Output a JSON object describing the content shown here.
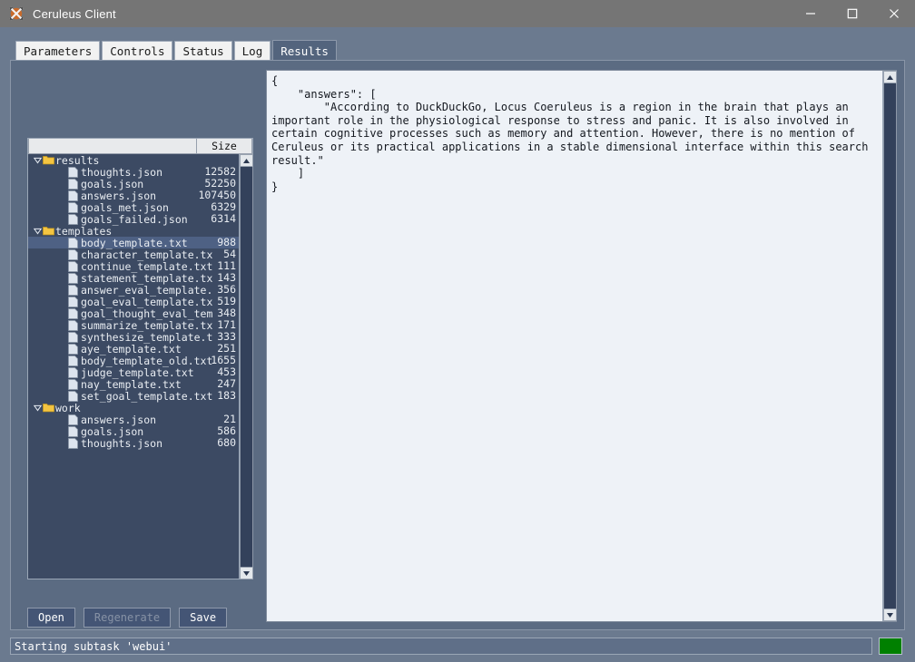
{
  "window": {
    "title": "Ceruleus Client",
    "icon": "crossed-swords-icon",
    "minimize_label": "—",
    "maximize_label": "□",
    "close_label": "✕"
  },
  "tabs": [
    {
      "label": "Parameters",
      "selected": false
    },
    {
      "label": "Controls",
      "selected": false
    },
    {
      "label": "Status",
      "selected": false
    },
    {
      "label": "Log",
      "selected": false
    },
    {
      "label": "Results",
      "selected": true
    }
  ],
  "tree": {
    "columns": [
      {
        "label": "",
        "key": "name"
      },
      {
        "label": "Size",
        "key": "size"
      }
    ],
    "rows": [
      {
        "type": "folder",
        "label": "results",
        "size": "",
        "expanded": true,
        "selected": false
      },
      {
        "type": "file",
        "label": "thoughts.json",
        "size": "12582",
        "selected": false
      },
      {
        "type": "file",
        "label": "goals.json",
        "size": "52250",
        "selected": false
      },
      {
        "type": "file",
        "label": "answers.json",
        "size": "107450",
        "selected": false
      },
      {
        "type": "file",
        "label": "goals_met.json",
        "size": "6329",
        "selected": false
      },
      {
        "type": "file",
        "label": "goals_failed.json",
        "size": "6314",
        "selected": false
      },
      {
        "type": "folder",
        "label": "templates",
        "size": "",
        "expanded": true,
        "selected": false
      },
      {
        "type": "file",
        "label": "body_template.txt",
        "size": "988",
        "selected": true
      },
      {
        "type": "file",
        "label": "character_template.tx",
        "size": "54",
        "selected": false
      },
      {
        "type": "file",
        "label": "continue_template.txt",
        "size": "111",
        "selected": false
      },
      {
        "type": "file",
        "label": "statement_template.tx",
        "size": "143",
        "selected": false
      },
      {
        "type": "file",
        "label": "answer_eval_template.",
        "size": "356",
        "selected": false
      },
      {
        "type": "file",
        "label": "goal_eval_template.tx",
        "size": "519",
        "selected": false
      },
      {
        "type": "file",
        "label": "goal_thought_eval_tem",
        "size": "348",
        "selected": false
      },
      {
        "type": "file",
        "label": "summarize_template.tx",
        "size": "171",
        "selected": false
      },
      {
        "type": "file",
        "label": "synthesize_template.t",
        "size": "333",
        "selected": false
      },
      {
        "type": "file",
        "label": "aye_template.txt",
        "size": "251",
        "selected": false
      },
      {
        "type": "file",
        "label": "body_template_old.txt",
        "size": "1655",
        "selected": false
      },
      {
        "type": "file",
        "label": "judge_template.txt",
        "size": "453",
        "selected": false
      },
      {
        "type": "file",
        "label": "nay_template.txt",
        "size": "247",
        "selected": false
      },
      {
        "type": "file",
        "label": "set_goal_template.txt",
        "size": "183",
        "selected": false
      },
      {
        "type": "folder",
        "label": "work",
        "size": "",
        "expanded": true,
        "selected": false
      },
      {
        "type": "file",
        "label": "answers.json",
        "size": "21",
        "selected": false
      },
      {
        "type": "file",
        "label": "goals.json",
        "size": "586",
        "selected": false
      },
      {
        "type": "file",
        "label": "thoughts.json",
        "size": "680",
        "selected": false
      }
    ]
  },
  "buttons": [
    {
      "label": "Open",
      "disabled": false
    },
    {
      "label": "Regenerate",
      "disabled": true
    },
    {
      "label": "Save",
      "disabled": false
    }
  ],
  "text_view": {
    "content": "{\n    \"answers\": [\n        \"According to DuckDuckGo, Locus Coeruleus is a region in the brain that plays an important role in the physiological response to stress and panic. It is also involved in certain cognitive processes such as memory and attention. However, there is no mention of Ceruleus or its practical applications in a stable dimensional interface within this search result.\"\n    ]\n}"
  },
  "statusbar": {
    "message": "Starting subtask 'webui'",
    "led_color": "#008000",
    "led_name": "status-led-green"
  }
}
